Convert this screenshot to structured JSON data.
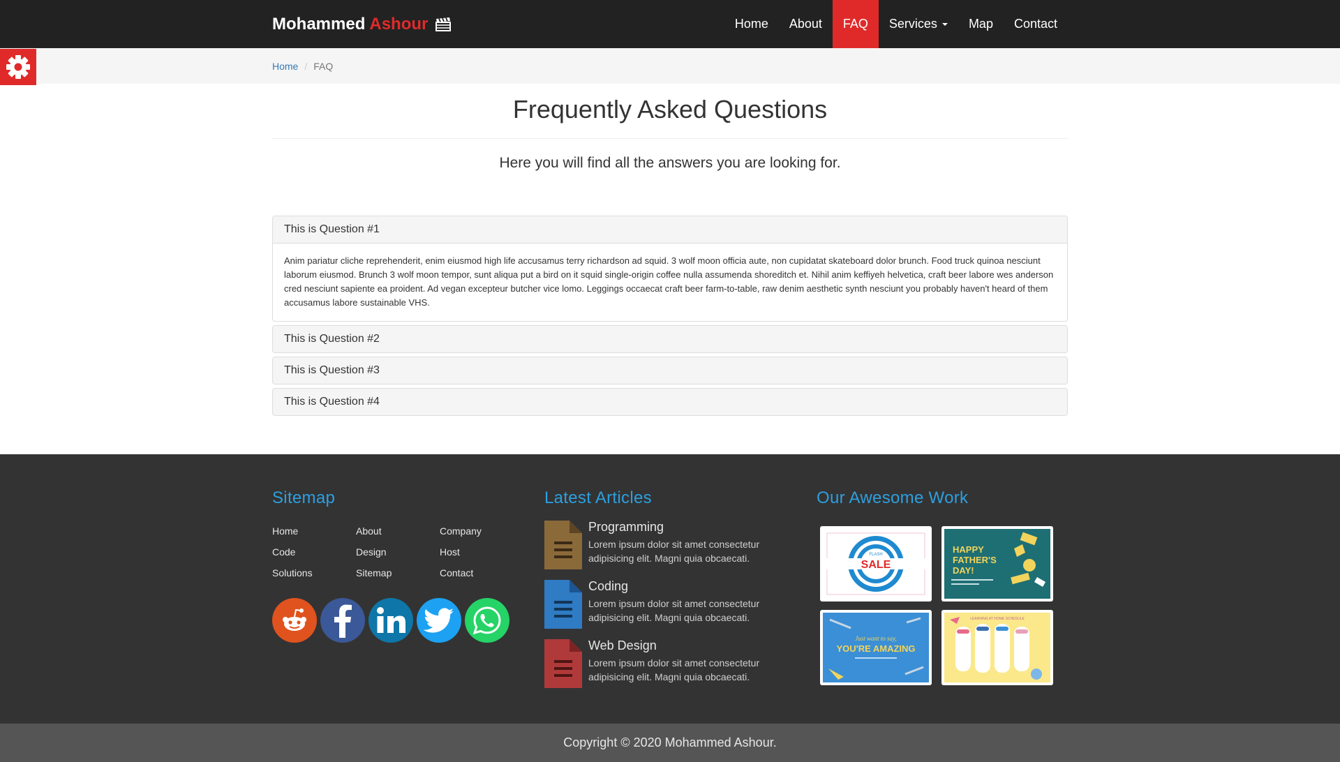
{
  "brand": {
    "first": "Mohammed",
    "second": "Ashour",
    "icon": "clapperboard-icon"
  },
  "nav": {
    "home": "Home",
    "about": "About",
    "faq": "FAQ",
    "services": "Services",
    "map": "Map",
    "contact": "Contact",
    "active": "FAQ"
  },
  "settings": {
    "icon": "gear-icon"
  },
  "breadcrumb": {
    "home": "Home",
    "current": "FAQ"
  },
  "header": {
    "title": "Frequently Asked Questions",
    "lead": "Here you will find all the answers you are looking for."
  },
  "faq": {
    "q1": "This is Question #1",
    "a1": "Anim pariatur cliche reprehenderit, enim eiusmod high life accusamus terry richardson ad squid. 3 wolf moon officia aute, non cupidatat skateboard dolor brunch. Food truck quinoa nesciunt laborum eiusmod. Brunch 3 wolf moon tempor, sunt aliqua put a bird on it squid single-origin coffee nulla assumenda shoreditch et. Nihil anim keffiyeh helvetica, craft beer labore wes anderson cred nesciunt sapiente ea proident. Ad vegan excepteur butcher vice lomo. Leggings occaecat craft beer farm-to-table, raw denim aesthetic synth nesciunt you probably haven't heard of them accusamus labore sustainable VHS.",
    "q2": "This is Question #2",
    "q3": "This is Question #3",
    "q4": "This is Question #4"
  },
  "footer": {
    "sitemap_title": "Sitemap",
    "sitemap": {
      "home": "Home",
      "about": "About",
      "company": "Company",
      "code": "Code",
      "design": "Design",
      "host": "Host",
      "solutions": "Solutions",
      "sitemap": "Sitemap",
      "contact": "Contact"
    },
    "social": [
      "reddit-icon",
      "facebook-icon",
      "linkedin-icon",
      "twitter-icon",
      "whatsapp-icon"
    ],
    "articles_title": "Latest Articles",
    "articles": {
      "a1_title": "Programming",
      "a1_text": "Lorem ipsum dolor sit amet consectetur adipisicing elit. Magni quia obcaecati.",
      "a2_title": "Coding",
      "a2_text": "Lorem ipsum dolor sit amet consectetur adipisicing elit. Magni quia obcaecati.",
      "a3_title": "Web Design",
      "a3_text": "Lorem ipsum dolor sit amet consectetur adipisicing elit. Magni quia obcaecati."
    },
    "work_title": "Our Awesome Work",
    "work": {
      "w1_small": "FLASH",
      "w1_big": "SALE",
      "w2_text": "HAPPY FATHER'S DAY!",
      "w3_small": "Just want to say,",
      "w3_big": "YOU'RE AMAZING",
      "w4_text": "LEARNING AT HOME SCHEDULE"
    },
    "copyright": "Copyright © 2020 Mohammed Ashour."
  },
  "colors": {
    "accent": "#e02a2a",
    "link": "#337ab7",
    "footer_heading": "#2d9fe0",
    "navbar": "#222222",
    "footer": "#333333"
  }
}
